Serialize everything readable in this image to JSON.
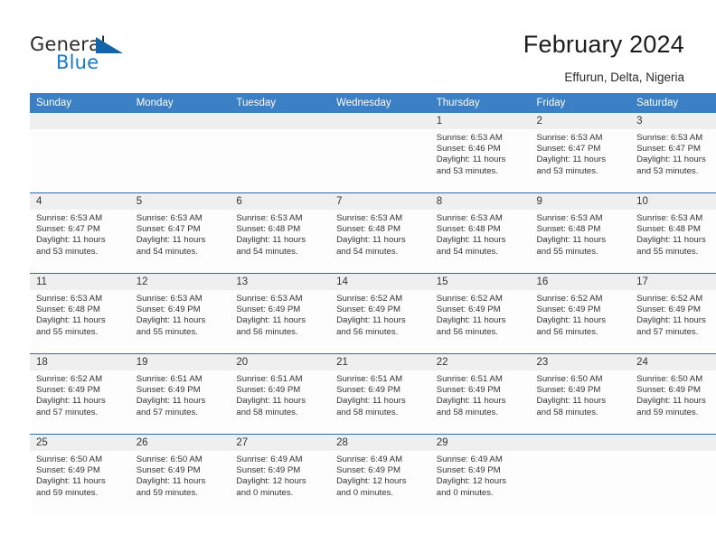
{
  "brand": {
    "name_part1": "General",
    "name_part2": "Blue",
    "logo_color": "#1263a8",
    "text_color": "#1878c8"
  },
  "header": {
    "title": "February 2024",
    "location": "Effurun, Delta, Nigeria"
  },
  "theme": {
    "header_blue": "#3b7fc4",
    "divider_blue": "#2a6db0",
    "band_gray": "#efefef"
  },
  "weekday_headers": [
    "Sunday",
    "Monday",
    "Tuesday",
    "Wednesday",
    "Thursday",
    "Friday",
    "Saturday"
  ],
  "weeks": [
    [
      {
        "day": "",
        "sunrise": "",
        "sunset": "",
        "daylight_line1": "",
        "daylight_line2": "",
        "empty": true
      },
      {
        "day": "",
        "sunrise": "",
        "sunset": "",
        "daylight_line1": "",
        "daylight_line2": "",
        "empty": true
      },
      {
        "day": "",
        "sunrise": "",
        "sunset": "",
        "daylight_line1": "",
        "daylight_line2": "",
        "empty": true
      },
      {
        "day": "",
        "sunrise": "",
        "sunset": "",
        "daylight_line1": "",
        "daylight_line2": "",
        "empty": true
      },
      {
        "day": "1",
        "sunrise": "Sunrise: 6:53 AM",
        "sunset": "Sunset: 6:46 PM",
        "daylight_line1": "Daylight: 11 hours",
        "daylight_line2": "and 53 minutes.",
        "empty": false
      },
      {
        "day": "2",
        "sunrise": "Sunrise: 6:53 AM",
        "sunset": "Sunset: 6:47 PM",
        "daylight_line1": "Daylight: 11 hours",
        "daylight_line2": "and 53 minutes.",
        "empty": false
      },
      {
        "day": "3",
        "sunrise": "Sunrise: 6:53 AM",
        "sunset": "Sunset: 6:47 PM",
        "daylight_line1": "Daylight: 11 hours",
        "daylight_line2": "and 53 minutes.",
        "empty": false
      }
    ],
    [
      {
        "day": "4",
        "sunrise": "Sunrise: 6:53 AM",
        "sunset": "Sunset: 6:47 PM",
        "daylight_line1": "Daylight: 11 hours",
        "daylight_line2": "and 53 minutes.",
        "empty": false
      },
      {
        "day": "5",
        "sunrise": "Sunrise: 6:53 AM",
        "sunset": "Sunset: 6:47 PM",
        "daylight_line1": "Daylight: 11 hours",
        "daylight_line2": "and 54 minutes.",
        "empty": false
      },
      {
        "day": "6",
        "sunrise": "Sunrise: 6:53 AM",
        "sunset": "Sunset: 6:48 PM",
        "daylight_line1": "Daylight: 11 hours",
        "daylight_line2": "and 54 minutes.",
        "empty": false
      },
      {
        "day": "7",
        "sunrise": "Sunrise: 6:53 AM",
        "sunset": "Sunset: 6:48 PM",
        "daylight_line1": "Daylight: 11 hours",
        "daylight_line2": "and 54 minutes.",
        "empty": false
      },
      {
        "day": "8",
        "sunrise": "Sunrise: 6:53 AM",
        "sunset": "Sunset: 6:48 PM",
        "daylight_line1": "Daylight: 11 hours",
        "daylight_line2": "and 54 minutes.",
        "empty": false
      },
      {
        "day": "9",
        "sunrise": "Sunrise: 6:53 AM",
        "sunset": "Sunset: 6:48 PM",
        "daylight_line1": "Daylight: 11 hours",
        "daylight_line2": "and 55 minutes.",
        "empty": false
      },
      {
        "day": "10",
        "sunrise": "Sunrise: 6:53 AM",
        "sunset": "Sunset: 6:48 PM",
        "daylight_line1": "Daylight: 11 hours",
        "daylight_line2": "and 55 minutes.",
        "empty": false
      }
    ],
    [
      {
        "day": "11",
        "sunrise": "Sunrise: 6:53 AM",
        "sunset": "Sunset: 6:48 PM",
        "daylight_line1": "Daylight: 11 hours",
        "daylight_line2": "and 55 minutes.",
        "empty": false
      },
      {
        "day": "12",
        "sunrise": "Sunrise: 6:53 AM",
        "sunset": "Sunset: 6:49 PM",
        "daylight_line1": "Daylight: 11 hours",
        "daylight_line2": "and 55 minutes.",
        "empty": false
      },
      {
        "day": "13",
        "sunrise": "Sunrise: 6:53 AM",
        "sunset": "Sunset: 6:49 PM",
        "daylight_line1": "Daylight: 11 hours",
        "daylight_line2": "and 56 minutes.",
        "empty": false
      },
      {
        "day": "14",
        "sunrise": "Sunrise: 6:52 AM",
        "sunset": "Sunset: 6:49 PM",
        "daylight_line1": "Daylight: 11 hours",
        "daylight_line2": "and 56 minutes.",
        "empty": false
      },
      {
        "day": "15",
        "sunrise": "Sunrise: 6:52 AM",
        "sunset": "Sunset: 6:49 PM",
        "daylight_line1": "Daylight: 11 hours",
        "daylight_line2": "and 56 minutes.",
        "empty": false
      },
      {
        "day": "16",
        "sunrise": "Sunrise: 6:52 AM",
        "sunset": "Sunset: 6:49 PM",
        "daylight_line1": "Daylight: 11 hours",
        "daylight_line2": "and 56 minutes.",
        "empty": false
      },
      {
        "day": "17",
        "sunrise": "Sunrise: 6:52 AM",
        "sunset": "Sunset: 6:49 PM",
        "daylight_line1": "Daylight: 11 hours",
        "daylight_line2": "and 57 minutes.",
        "empty": false
      }
    ],
    [
      {
        "day": "18",
        "sunrise": "Sunrise: 6:52 AM",
        "sunset": "Sunset: 6:49 PM",
        "daylight_line1": "Daylight: 11 hours",
        "daylight_line2": "and 57 minutes.",
        "empty": false
      },
      {
        "day": "19",
        "sunrise": "Sunrise: 6:51 AM",
        "sunset": "Sunset: 6:49 PM",
        "daylight_line1": "Daylight: 11 hours",
        "daylight_line2": "and 57 minutes.",
        "empty": false
      },
      {
        "day": "20",
        "sunrise": "Sunrise: 6:51 AM",
        "sunset": "Sunset: 6:49 PM",
        "daylight_line1": "Daylight: 11 hours",
        "daylight_line2": "and 58 minutes.",
        "empty": false
      },
      {
        "day": "21",
        "sunrise": "Sunrise: 6:51 AM",
        "sunset": "Sunset: 6:49 PM",
        "daylight_line1": "Daylight: 11 hours",
        "daylight_line2": "and 58 minutes.",
        "empty": false
      },
      {
        "day": "22",
        "sunrise": "Sunrise: 6:51 AM",
        "sunset": "Sunset: 6:49 PM",
        "daylight_line1": "Daylight: 11 hours",
        "daylight_line2": "and 58 minutes.",
        "empty": false
      },
      {
        "day": "23",
        "sunrise": "Sunrise: 6:50 AM",
        "sunset": "Sunset: 6:49 PM",
        "daylight_line1": "Daylight: 11 hours",
        "daylight_line2": "and 58 minutes.",
        "empty": false
      },
      {
        "day": "24",
        "sunrise": "Sunrise: 6:50 AM",
        "sunset": "Sunset: 6:49 PM",
        "daylight_line1": "Daylight: 11 hours",
        "daylight_line2": "and 59 minutes.",
        "empty": false
      }
    ],
    [
      {
        "day": "25",
        "sunrise": "Sunrise: 6:50 AM",
        "sunset": "Sunset: 6:49 PM",
        "daylight_line1": "Daylight: 11 hours",
        "daylight_line2": "and 59 minutes.",
        "empty": false
      },
      {
        "day": "26",
        "sunrise": "Sunrise: 6:50 AM",
        "sunset": "Sunset: 6:49 PM",
        "daylight_line1": "Daylight: 11 hours",
        "daylight_line2": "and 59 minutes.",
        "empty": false
      },
      {
        "day": "27",
        "sunrise": "Sunrise: 6:49 AM",
        "sunset": "Sunset: 6:49 PM",
        "daylight_line1": "Daylight: 12 hours",
        "daylight_line2": "and 0 minutes.",
        "empty": false
      },
      {
        "day": "28",
        "sunrise": "Sunrise: 6:49 AM",
        "sunset": "Sunset: 6:49 PM",
        "daylight_line1": "Daylight: 12 hours",
        "daylight_line2": "and 0 minutes.",
        "empty": false
      },
      {
        "day": "29",
        "sunrise": "Sunrise: 6:49 AM",
        "sunset": "Sunset: 6:49 PM",
        "daylight_line1": "Daylight: 12 hours",
        "daylight_line2": "and 0 minutes.",
        "empty": false
      },
      {
        "day": "",
        "sunrise": "",
        "sunset": "",
        "daylight_line1": "",
        "daylight_line2": "",
        "empty": true
      },
      {
        "day": "",
        "sunrise": "",
        "sunset": "",
        "daylight_line1": "",
        "daylight_line2": "",
        "empty": true
      }
    ]
  ]
}
